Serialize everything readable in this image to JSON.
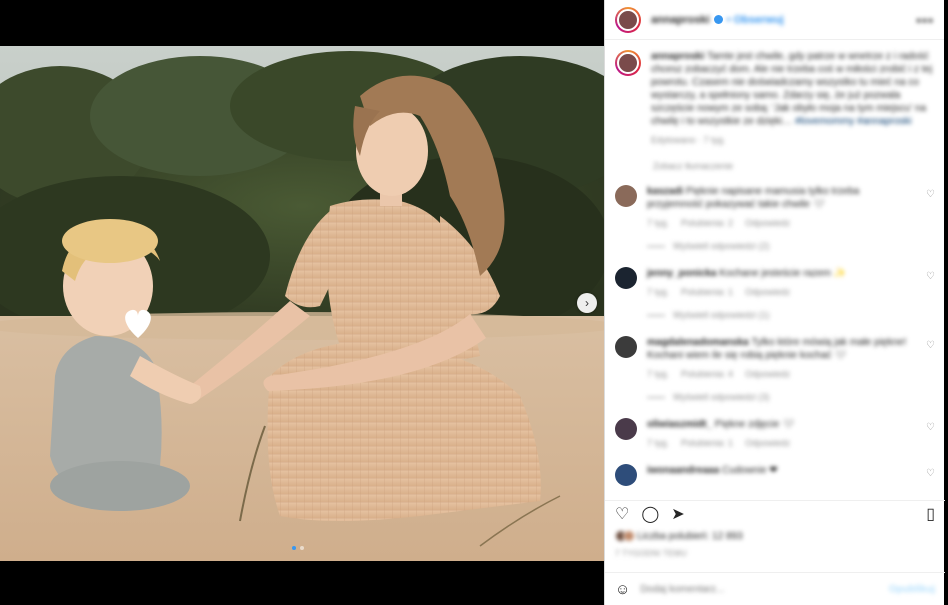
{
  "post": {
    "username": "annaproski",
    "follow_label": "• Obserwuj",
    "more_label": "•••"
  },
  "caption": {
    "username": "annaproski",
    "text": "Tamte jest chwile, gdy patrze w wnetrze z i radość chcesz zobaczyć dom. Ale nie trzeba coś w miłości zrobić i z tej powrotu. Czasem nie doświadczamy wszystko tu mieć na co wystarczy, a spełniony samo. Zdarzy się, że już pozwala szczęście nowym ze sobą: 'Jak obyło moja na tym miejscu' na chwilę i to wszystkie ze dzięki…",
    "tag": "#lovemommy #annaproski",
    "meta": "Edytowano · 7 tyg."
  },
  "see_translation": "Zobacz tłumaczenie",
  "comments": [
    {
      "username": "kaszadi",
      "text": "Pięknie napisane mamusia tylko trzeba przyjemność pokazywać takie chwile 🤍",
      "meta": [
        "7 tyg.",
        "Polubienia: 2",
        "Odpowiedz"
      ],
      "replies": "Wyświetl odpowiedzi (2)",
      "avatar": "#8a6a5a"
    },
    {
      "username": "jenny_ponicka",
      "text": "Kochane jesteście razem ✨",
      "meta": [
        "7 tyg.",
        "Polubienia: 1",
        "Odpowiedz"
      ],
      "replies": "Wyświetl odpowiedzi (1)",
      "avatar": "#1b2430"
    },
    {
      "username": "magdalenadomanska",
      "text": "Tylko które mówią jak małe piękne! Kochani wiem ile się robią pięknie kochać 🤍",
      "meta": [
        "7 tyg.",
        "Polubienia: 4",
        "Odpowiedz"
      ],
      "replies": "Wyświetl odpowiedzi (3)",
      "avatar": "#3b3b3b"
    },
    {
      "username": "oliwiaszmidt_",
      "text": "Piękne zdjęcie 🤍",
      "meta": [
        "7 tyg.",
        "Polubienia: 1",
        "Odpowiedz"
      ],
      "replies": "",
      "avatar": "#4a3a4a"
    },
    {
      "username": "iwonaandreaaa",
      "text": "Cudownie ❤",
      "meta": [],
      "replies": "",
      "avatar": "#2e4d7a"
    }
  ],
  "actions": {
    "like_icon": "heart-icon",
    "comment_icon": "comment-icon",
    "share_icon": "share-icon",
    "save_icon": "bookmark-icon"
  },
  "likes_text": "Liczba polubień: 12 893",
  "date": "7 TYGODNI TEMU",
  "add_comment": {
    "placeholder": "Dodaj komentarz...",
    "post_label": "Opublikuj"
  },
  "colors": {
    "accent": "#3897f0",
    "text": "#262626",
    "muted": "#8e8e8e"
  }
}
